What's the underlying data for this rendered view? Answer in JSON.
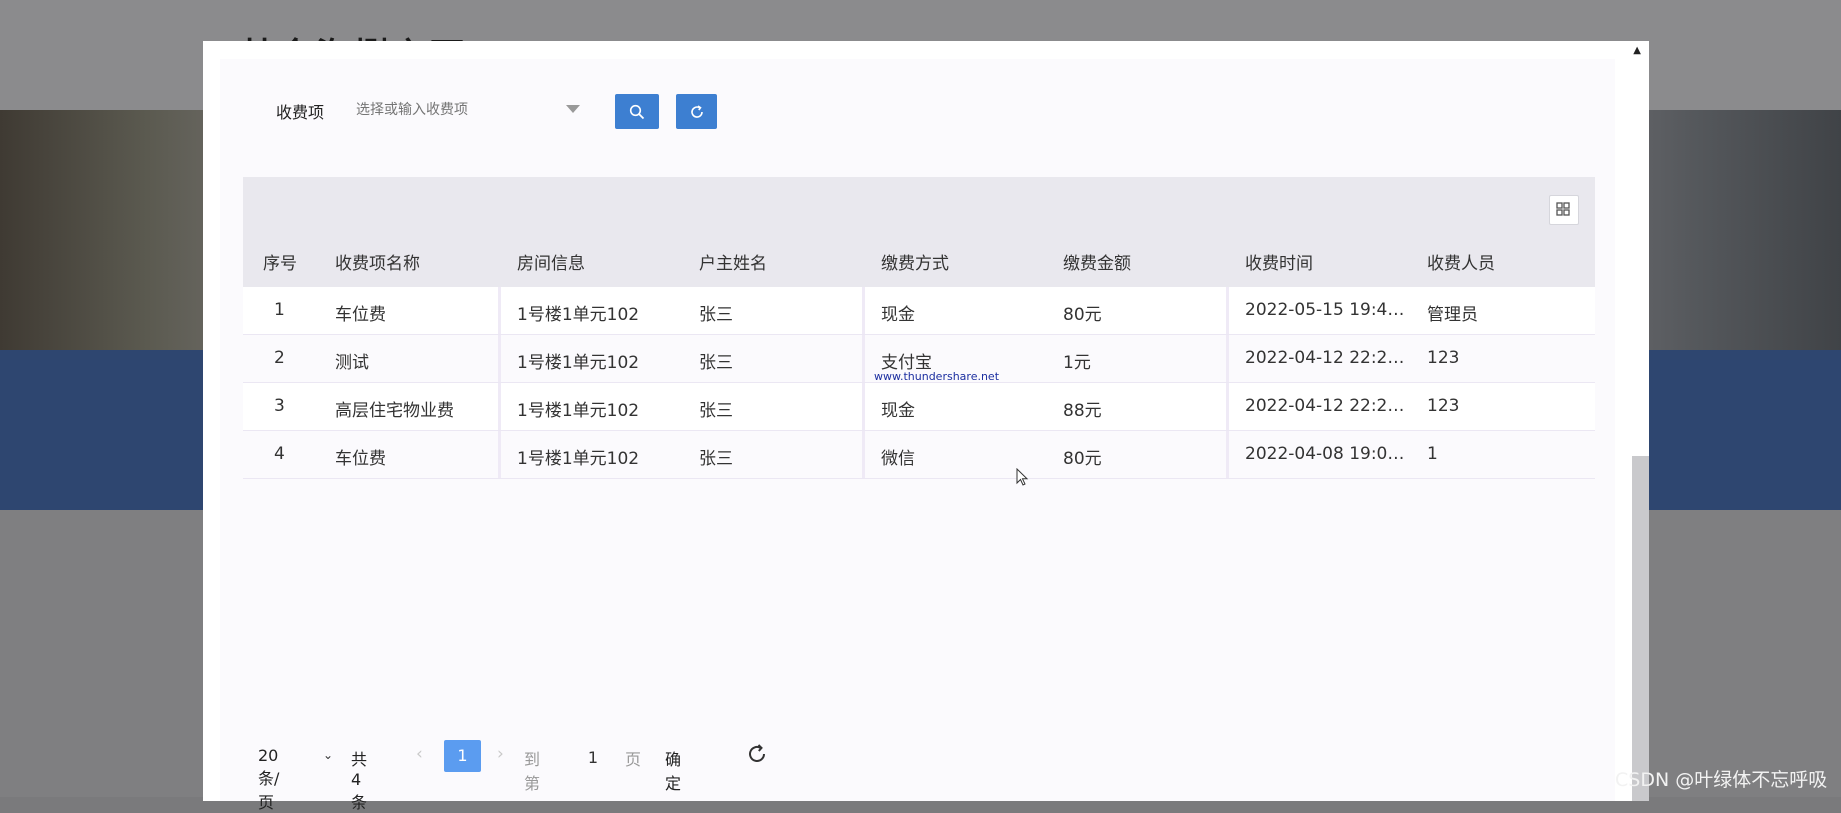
{
  "background": {
    "title": "基金海捌之面"
  },
  "search": {
    "label": "收费项",
    "placeholder": "选择或输入收费项"
  },
  "table": {
    "columns": [
      "序号",
      "收费项名称",
      "房间信息",
      "户主姓名",
      "缴费方式",
      "缴费金额",
      "收费时间",
      "收费人员"
    ],
    "rows": [
      [
        "1",
        "车位费",
        "1号楼1单元102",
        "张三",
        "现金",
        "80元",
        "2022-05-15 19:4…",
        "管理员"
      ],
      [
        "2",
        "测试",
        "1号楼1单元102",
        "张三",
        "支付宝",
        "1元",
        "2022-04-12 22:2…",
        "123"
      ],
      [
        "3",
        "高层住宅物业费",
        "1号楼1单元102",
        "张三",
        "现金",
        "88元",
        "2022-04-12 22:2…",
        "123"
      ],
      [
        "4",
        "车位费",
        "1号楼1单元102",
        "张三",
        "微信",
        "80元",
        "2022-04-08 19:0…",
        "1"
      ]
    ]
  },
  "watermark": "www.thundershare.net",
  "pagination": {
    "page_size": "20 条/页",
    "total": "共 4 条",
    "current_page": "1",
    "goto_label": "到第",
    "goto_value": "1",
    "page_unit": "页",
    "confirm": "确定"
  },
  "credit": "CSDN @叶绿体不忘呼吸"
}
